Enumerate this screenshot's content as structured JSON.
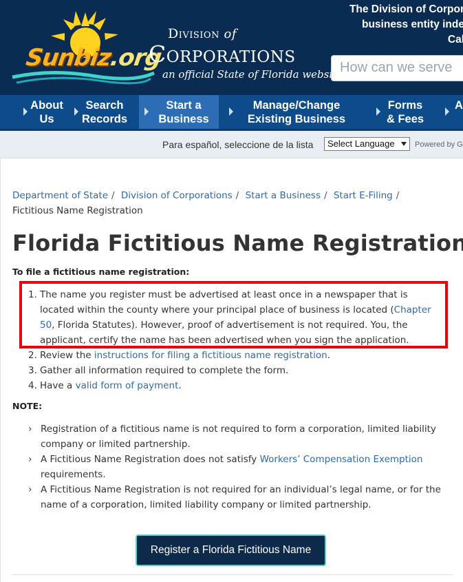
{
  "header": {
    "logo_main": "Sunbiz",
    "logo_tld": ".org",
    "division_line1": "Division",
    "division_of": "of",
    "division_line2": "Corporations",
    "tagline": "an official State of Florida website",
    "right_text_1": "The Division of Corpor",
    "right_text_2": "business entity inde",
    "right_text_3": "Cal",
    "search_placeholder": "How can we serve"
  },
  "nav": {
    "items": [
      {
        "line1": "About",
        "line2": "Us",
        "active": false
      },
      {
        "line1": "Search",
        "line2": "Records",
        "active": false
      },
      {
        "line1": "Start a",
        "line2": "Business",
        "active": true
      },
      {
        "line1": "Manage/Change",
        "line2": "Existing Business",
        "active": false
      },
      {
        "line1": "Forms",
        "line2": "& Fees",
        "active": false
      },
      {
        "line1": "A",
        "line2": "",
        "active": false
      }
    ]
  },
  "language": {
    "label": "Para español, seleccione de la lista",
    "select_value": "Select Language",
    "powered_by": "Powered by G"
  },
  "breadcrumb": {
    "items": [
      "Department of State",
      "Division of Corporations",
      "Start a Business",
      "Start E-Filing"
    ],
    "current": "Fictitious Name Registration"
  },
  "page_title": "Florida Fictitious Name Registration",
  "intro": "To file a fictitious name registration:",
  "steps": {
    "s1_num": "1.",
    "s1_text_a": "The name you register must be advertised at least once in a newspaper that is located within the county where your principal place of business is located (",
    "s1_link": "Chapter 50",
    "s1_text_b": ", Florida Statutes). However, proof of advertisement is not required. You, the applicant, certify the name has been advertised when you sign the application.",
    "s2_num": "2.",
    "s2_text_a": "Review the ",
    "s2_link": "instructions for filing a fictitious name registration",
    "s2_text_b": ".",
    "s3_num": "3.",
    "s3_text": "Gather all information required to complete the form.",
    "s4_num": "4.",
    "s4_text_a": "Have a ",
    "s4_link": "valid form of payment",
    "s4_text_b": "."
  },
  "note_label": "NOTE:",
  "notes": {
    "n1": "Registration of a fictitious name is not required to form a corporation, limited liability company or limited partnership.",
    "n2_a": "A Fictitious Name Registration does not satisfy ",
    "n2_link": "Workers’ Compensation Exemption",
    "n2_b": " requirements.",
    "n3": "A Fictitious Name Registration is not required for an individual’s legal name, or for the name of a corporation, limited liability company or limited partnership."
  },
  "register_button": "Register a Florida Fictitious Name",
  "colors": {
    "header_bg": "#0a2b52",
    "nav_bg": "#0e4b8a",
    "nav_active": "#2d6db5",
    "link": "#2e6aa8",
    "highlight": "#e8000c",
    "button_bg": "#0e2a4a",
    "button_border": "#5ad1d1"
  }
}
